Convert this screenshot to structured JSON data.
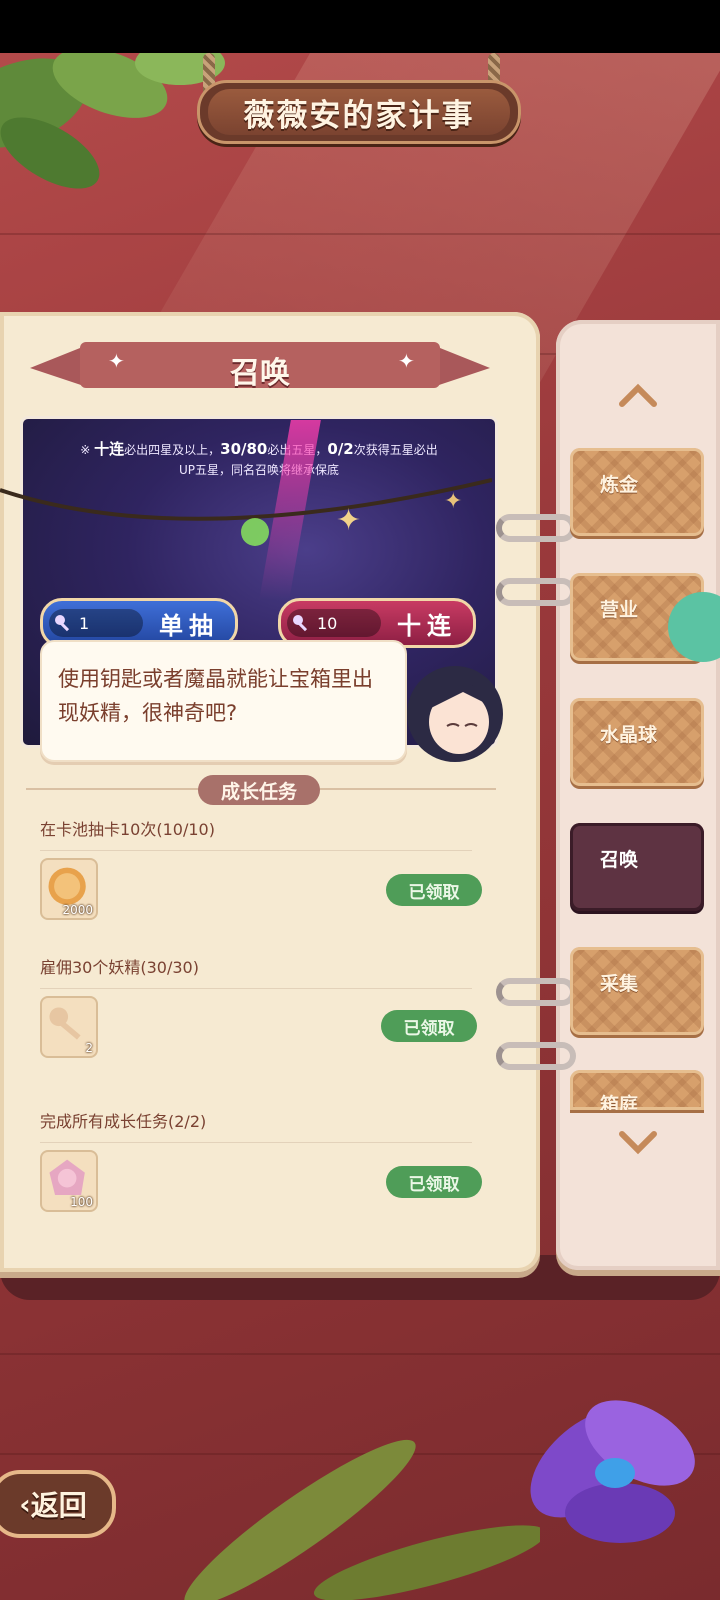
{
  "title": "薇薇安的家计事",
  "section_title": "召唤",
  "banner": {
    "note_line1_prefix": "※",
    "note_ten": "十连",
    "note_line1_a": "必出四星及以上，",
    "note_pity": "30/80",
    "note_line1_b": "必出五星，",
    "note_up": "0/2",
    "note_line1_c": "次获得五星必出",
    "note_line2": "UP五星，同名召唤将继承保底"
  },
  "pull_single": {
    "count": "1",
    "label": "单抽"
  },
  "pull_ten": {
    "count": "10",
    "label": "十连"
  },
  "bubble_text": "使用钥匙或者魔晶就能让宝箱里出现妖精，很神奇吧?",
  "growth_header": "成长任务",
  "tasks": [
    {
      "title": "在卡池抽卡10次(10/10)",
      "reward_count": "2000",
      "reward_icon": "coin-icon",
      "status": "已领取"
    },
    {
      "title": "雇佣30个妖精(30/30)",
      "reward_count": "2",
      "reward_icon": "key-icon",
      "status": "已领取"
    },
    {
      "title": "完成所有成长任务(2/2)",
      "reward_count": "100",
      "reward_icon": "crystal-icon",
      "status": "已领取"
    }
  ],
  "tabs": [
    {
      "label": "炼金",
      "active": false
    },
    {
      "label": "营业",
      "active": false
    },
    {
      "label": "水晶球",
      "active": false
    },
    {
      "label": "召唤",
      "active": true
    },
    {
      "label": "采集",
      "active": false
    },
    {
      "label": "箱庭",
      "active": false
    }
  ],
  "back_label": "返回",
  "colors": {
    "accent_green": "#4f9d58",
    "active_tab": "#5e3342",
    "background": "#9b3a3c"
  }
}
